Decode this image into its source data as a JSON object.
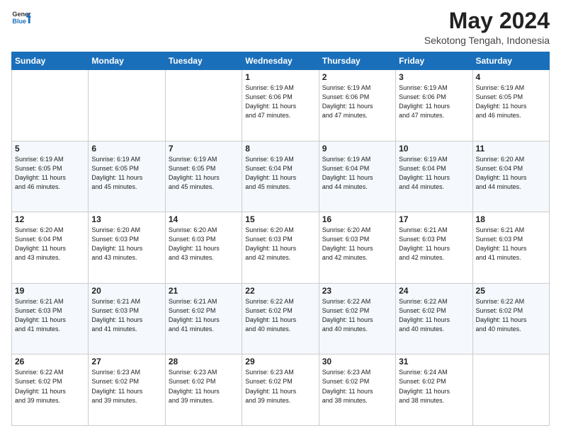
{
  "logo": {
    "line1": "General",
    "line2": "Blue"
  },
  "title": "May 2024",
  "subtitle": "Sekotong Tengah, Indonesia",
  "days_of_week": [
    "Sunday",
    "Monday",
    "Tuesday",
    "Wednesday",
    "Thursday",
    "Friday",
    "Saturday"
  ],
  "weeks": [
    [
      {
        "day": "",
        "info": ""
      },
      {
        "day": "",
        "info": ""
      },
      {
        "day": "",
        "info": ""
      },
      {
        "day": "1",
        "info": "Sunrise: 6:19 AM\nSunset: 6:06 PM\nDaylight: 11 hours\nand 47 minutes."
      },
      {
        "day": "2",
        "info": "Sunrise: 6:19 AM\nSunset: 6:06 PM\nDaylight: 11 hours\nand 47 minutes."
      },
      {
        "day": "3",
        "info": "Sunrise: 6:19 AM\nSunset: 6:06 PM\nDaylight: 11 hours\nand 47 minutes."
      },
      {
        "day": "4",
        "info": "Sunrise: 6:19 AM\nSunset: 6:05 PM\nDaylight: 11 hours\nand 46 minutes."
      }
    ],
    [
      {
        "day": "5",
        "info": "Sunrise: 6:19 AM\nSunset: 6:05 PM\nDaylight: 11 hours\nand 46 minutes."
      },
      {
        "day": "6",
        "info": "Sunrise: 6:19 AM\nSunset: 6:05 PM\nDaylight: 11 hours\nand 45 minutes."
      },
      {
        "day": "7",
        "info": "Sunrise: 6:19 AM\nSunset: 6:05 PM\nDaylight: 11 hours\nand 45 minutes."
      },
      {
        "day": "8",
        "info": "Sunrise: 6:19 AM\nSunset: 6:04 PM\nDaylight: 11 hours\nand 45 minutes."
      },
      {
        "day": "9",
        "info": "Sunrise: 6:19 AM\nSunset: 6:04 PM\nDaylight: 11 hours\nand 44 minutes."
      },
      {
        "day": "10",
        "info": "Sunrise: 6:19 AM\nSunset: 6:04 PM\nDaylight: 11 hours\nand 44 minutes."
      },
      {
        "day": "11",
        "info": "Sunrise: 6:20 AM\nSunset: 6:04 PM\nDaylight: 11 hours\nand 44 minutes."
      }
    ],
    [
      {
        "day": "12",
        "info": "Sunrise: 6:20 AM\nSunset: 6:04 PM\nDaylight: 11 hours\nand 43 minutes."
      },
      {
        "day": "13",
        "info": "Sunrise: 6:20 AM\nSunset: 6:03 PM\nDaylight: 11 hours\nand 43 minutes."
      },
      {
        "day": "14",
        "info": "Sunrise: 6:20 AM\nSunset: 6:03 PM\nDaylight: 11 hours\nand 43 minutes."
      },
      {
        "day": "15",
        "info": "Sunrise: 6:20 AM\nSunset: 6:03 PM\nDaylight: 11 hours\nand 42 minutes."
      },
      {
        "day": "16",
        "info": "Sunrise: 6:20 AM\nSunset: 6:03 PM\nDaylight: 11 hours\nand 42 minutes."
      },
      {
        "day": "17",
        "info": "Sunrise: 6:21 AM\nSunset: 6:03 PM\nDaylight: 11 hours\nand 42 minutes."
      },
      {
        "day": "18",
        "info": "Sunrise: 6:21 AM\nSunset: 6:03 PM\nDaylight: 11 hours\nand 41 minutes."
      }
    ],
    [
      {
        "day": "19",
        "info": "Sunrise: 6:21 AM\nSunset: 6:03 PM\nDaylight: 11 hours\nand 41 minutes."
      },
      {
        "day": "20",
        "info": "Sunrise: 6:21 AM\nSunset: 6:03 PM\nDaylight: 11 hours\nand 41 minutes."
      },
      {
        "day": "21",
        "info": "Sunrise: 6:21 AM\nSunset: 6:02 PM\nDaylight: 11 hours\nand 41 minutes."
      },
      {
        "day": "22",
        "info": "Sunrise: 6:22 AM\nSunset: 6:02 PM\nDaylight: 11 hours\nand 40 minutes."
      },
      {
        "day": "23",
        "info": "Sunrise: 6:22 AM\nSunset: 6:02 PM\nDaylight: 11 hours\nand 40 minutes."
      },
      {
        "day": "24",
        "info": "Sunrise: 6:22 AM\nSunset: 6:02 PM\nDaylight: 11 hours\nand 40 minutes."
      },
      {
        "day": "25",
        "info": "Sunrise: 6:22 AM\nSunset: 6:02 PM\nDaylight: 11 hours\nand 40 minutes."
      }
    ],
    [
      {
        "day": "26",
        "info": "Sunrise: 6:22 AM\nSunset: 6:02 PM\nDaylight: 11 hours\nand 39 minutes."
      },
      {
        "day": "27",
        "info": "Sunrise: 6:23 AM\nSunset: 6:02 PM\nDaylight: 11 hours\nand 39 minutes."
      },
      {
        "day": "28",
        "info": "Sunrise: 6:23 AM\nSunset: 6:02 PM\nDaylight: 11 hours\nand 39 minutes."
      },
      {
        "day": "29",
        "info": "Sunrise: 6:23 AM\nSunset: 6:02 PM\nDaylight: 11 hours\nand 39 minutes."
      },
      {
        "day": "30",
        "info": "Sunrise: 6:23 AM\nSunset: 6:02 PM\nDaylight: 11 hours\nand 38 minutes."
      },
      {
        "day": "31",
        "info": "Sunrise: 6:24 AM\nSunset: 6:02 PM\nDaylight: 11 hours\nand 38 minutes."
      },
      {
        "day": "",
        "info": ""
      }
    ]
  ]
}
